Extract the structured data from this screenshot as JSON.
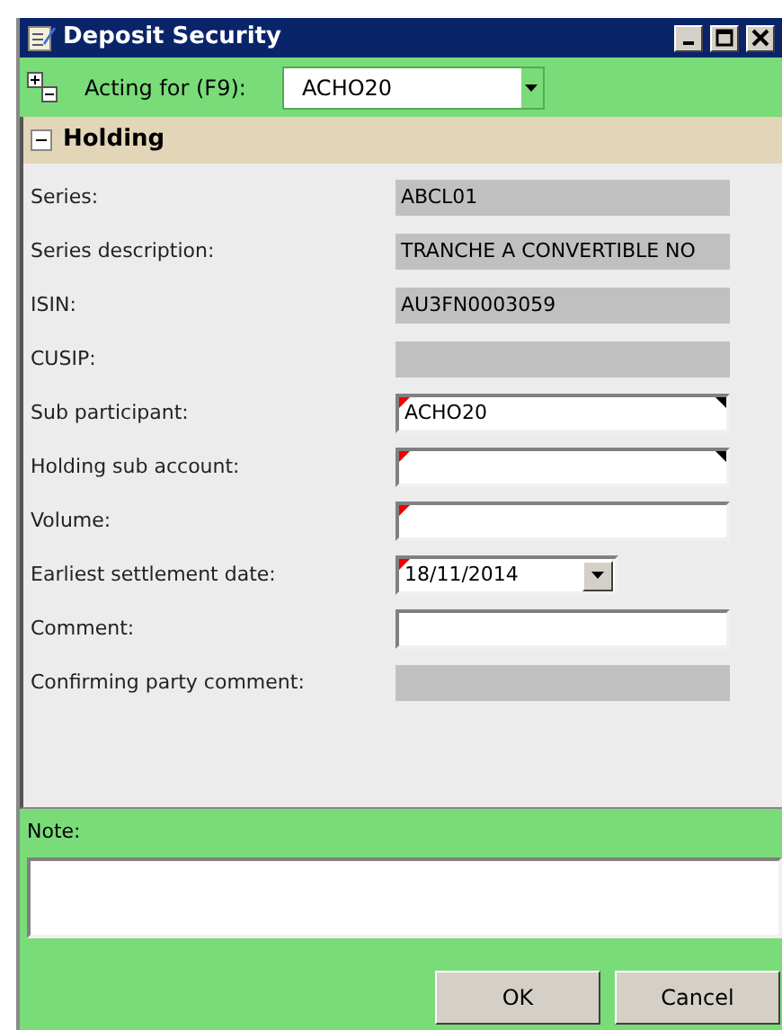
{
  "window": {
    "title": "Deposit Security"
  },
  "toolbar": {
    "label": "Acting for (F9):",
    "value": "ACHO20"
  },
  "section": {
    "title": "Holding",
    "expanded": true
  },
  "fields": [
    {
      "label": "Series:",
      "kind": "readonly",
      "value": "ABCL01"
    },
    {
      "label": "Series description:",
      "kind": "readonly",
      "value": "TRANCHE A CONVERTIBLE NO"
    },
    {
      "label": "ISIN:",
      "kind": "readonly",
      "value": "AU3FN0003059"
    },
    {
      "label": "CUSIP:",
      "kind": "readonly"
    },
    {
      "label": "Sub participant:",
      "kind": "text",
      "required": true,
      "lookup": true,
      "value": "ACHO20"
    },
    {
      "label": "Holding sub account:",
      "kind": "text",
      "required": true,
      "lookup": true
    },
    {
      "label": "Volume:",
      "kind": "text",
      "required": true,
      "lookup": false
    },
    {
      "label": "Earliest settlement date:",
      "kind": "date",
      "required": true,
      "value": "18/11/2014"
    },
    {
      "label": "Comment:",
      "kind": "text",
      "required": false,
      "lookup": false
    },
    {
      "label": "Confirming party comment:",
      "kind": "readonly"
    }
  ],
  "note": {
    "label": "Note:"
  },
  "buttons": [
    "OK",
    "Cancel"
  ]
}
